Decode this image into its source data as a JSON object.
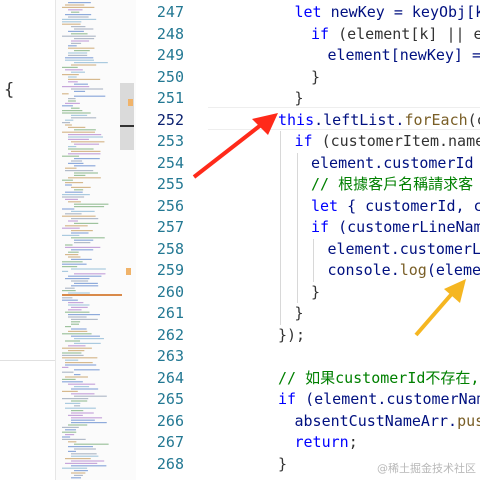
{
  "left_pane": {
    "brace": "{"
  },
  "editor": {
    "line_numbers": [
      "247",
      "248",
      "249",
      "250",
      "251",
      "252",
      "253",
      "254",
      "255",
      "256",
      "257",
      "258",
      "259",
      "260",
      "261",
      "262",
      "263",
      "264",
      "265",
      "266",
      "267",
      "268"
    ],
    "active_line": "252",
    "lines": [
      [
        {
          "t": "let",
          "c": "k"
        },
        {
          "t": " newKey = keyObj[k]",
          "c": "v"
        }
      ],
      [
        {
          "t": "if",
          "c": "k"
        },
        {
          "t": " (element[k] || elem",
          "c": "p"
        }
      ],
      [
        {
          "t": "element[newKey] = el",
          "c": "v"
        }
      ],
      [
        {
          "t": "}",
          "c": "p"
        }
      ],
      [
        {
          "t": "}",
          "c": "p"
        }
      ],
      [
        {
          "t": "this",
          "c": "k"
        },
        {
          "t": ".leftList.",
          "c": "v"
        },
        {
          "t": "forEach",
          "c": "f"
        },
        {
          "t": "(cu",
          "c": "p"
        }
      ],
      [
        {
          "t": "if",
          "c": "k"
        },
        {
          "t": " (customerItem.name",
          "c": "p"
        }
      ],
      [
        {
          "t": "element.customerId =",
          "c": "v"
        }
      ],
      [
        {
          "t": "// 根據客戶名稱請求客",
          "c": "c"
        }
      ],
      [
        {
          "t": "let",
          "c": "k"
        },
        {
          "t": " { customerId, cu",
          "c": "v"
        }
      ],
      [
        {
          "t": "if",
          "c": "k"
        },
        {
          "t": " (customerLineName",
          "c": "v"
        }
      ],
      [
        {
          "t": "element.customerLi",
          "c": "v"
        }
      ],
      [
        {
          "t": "console.",
          "c": "v"
        },
        {
          "t": "log",
          "c": "f"
        },
        {
          "t": "(elemen",
          "c": "v"
        }
      ],
      [
        {
          "t": "}",
          "c": "p"
        }
      ],
      [
        {
          "t": "}",
          "c": "p"
        }
      ],
      [
        {
          "t": "});",
          "c": "p"
        }
      ],
      [
        {
          "t": "",
          "c": "p"
        }
      ],
      [
        {
          "t": "// 如果customerId不存在,",
          "c": "c"
        }
      ],
      [
        {
          "t": "if",
          "c": "k"
        },
        {
          "t": " (element.customerName",
          "c": "v"
        }
      ],
      [
        {
          "t": "absentCustNameArr.",
          "c": "v"
        },
        {
          "t": "push",
          "c": "f"
        }
      ],
      [
        {
          "t": "return",
          "c": "k"
        },
        {
          "t": ";",
          "c": "p"
        }
      ],
      [
        {
          "t": "}",
          "c": "p"
        }
      ]
    ],
    "indents": [
      1,
      2,
      3,
      2,
      1,
      0,
      1,
      2,
      2,
      2,
      2,
      3,
      3,
      2,
      1,
      0,
      0,
      0,
      0,
      1,
      1,
      0
    ]
  },
  "annotations": {
    "red_arrow_color": "#ff2a1a",
    "yellow_arrow_color": "#f5b621"
  },
  "watermark": "@稀土掘金技术社区"
}
